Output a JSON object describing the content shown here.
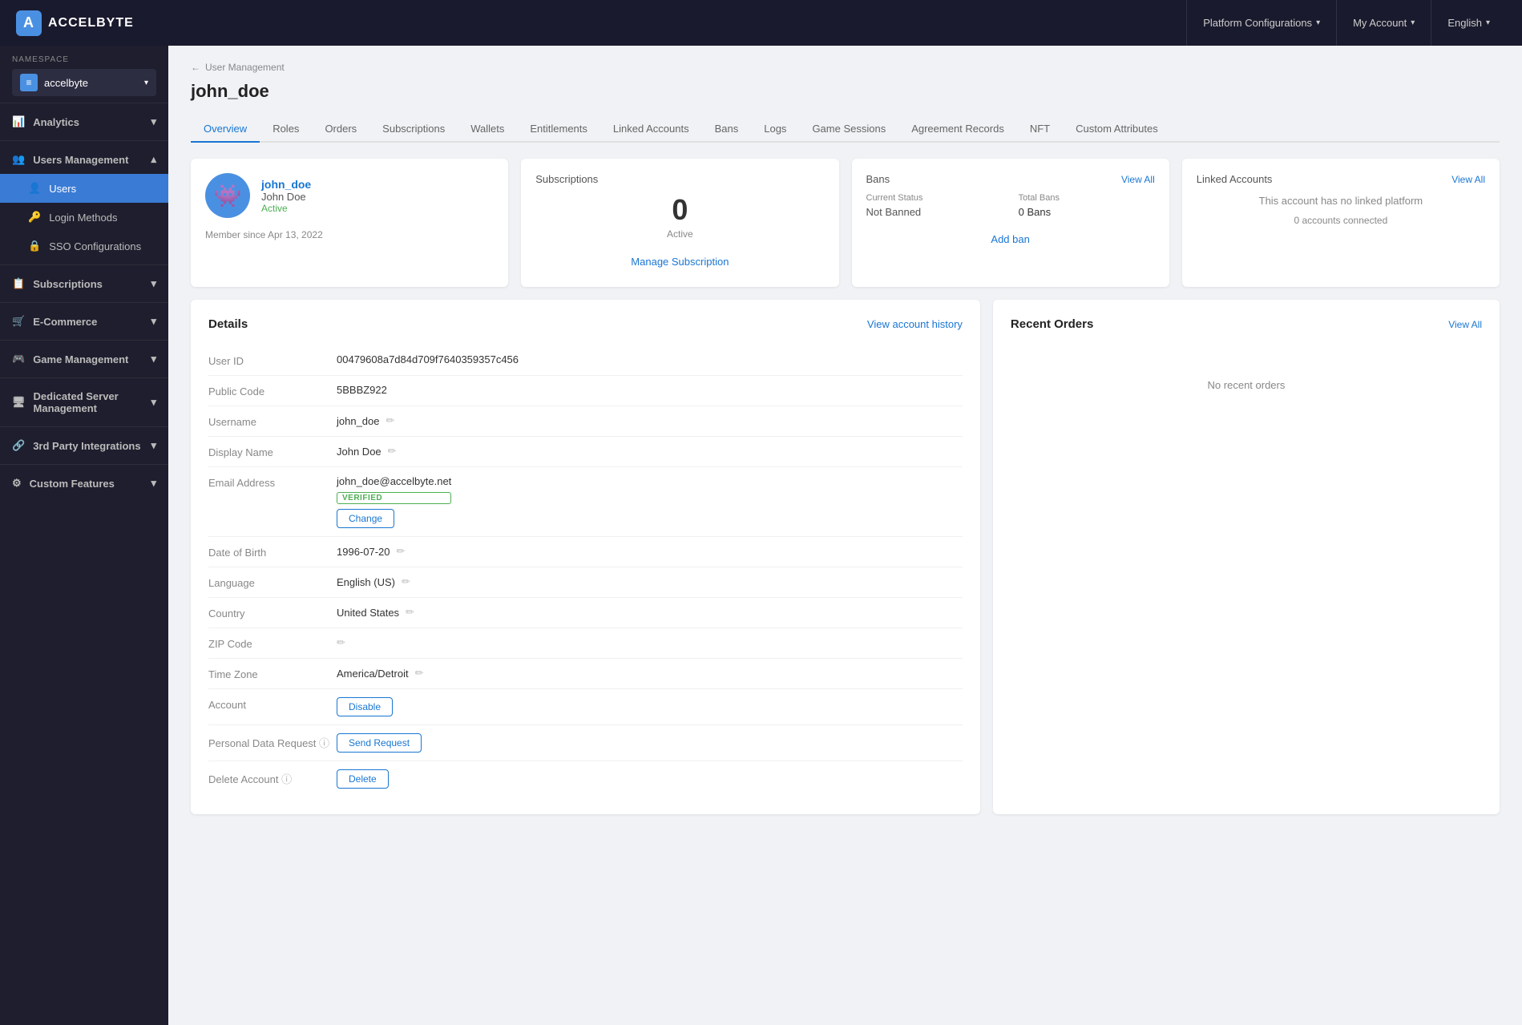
{
  "topNav": {
    "logo": "ACCELBYTE",
    "platformConfigurations": "Platform Configurations",
    "myAccount": "My Account",
    "english": "English"
  },
  "sidebar": {
    "namespaceLabel": "NAMESPACE",
    "namespace": "accelbyte",
    "sections": [
      {
        "id": "analytics",
        "label": "Analytics",
        "expandable": true
      },
      {
        "id": "usersManagement",
        "label": "Users Management",
        "expandable": true,
        "expanded": true
      },
      {
        "id": "users",
        "label": "Users",
        "sub": true,
        "active": true
      },
      {
        "id": "loginMethods",
        "label": "Login Methods",
        "sub": true
      },
      {
        "id": "ssoConfigurations",
        "label": "SSO Configurations",
        "sub": true
      },
      {
        "id": "subscriptions",
        "label": "Subscriptions",
        "expandable": true
      },
      {
        "id": "eCommerce",
        "label": "E-Commerce",
        "expandable": true
      },
      {
        "id": "gameManagement",
        "label": "Game Management",
        "expandable": true
      },
      {
        "id": "dedicatedServerManagement",
        "label": "Dedicated Server Management",
        "expandable": true
      },
      {
        "id": "thirdPartyIntegrations",
        "label": "3rd Party Integrations",
        "expandable": true
      },
      {
        "id": "customFeatures",
        "label": "Custom Features",
        "expandable": true
      }
    ]
  },
  "breadcrumb": {
    "parent": "User Management",
    "arrow": "←"
  },
  "pageTitle": "john_doe",
  "tabs": [
    {
      "id": "overview",
      "label": "Overview",
      "active": true
    },
    {
      "id": "roles",
      "label": "Roles"
    },
    {
      "id": "orders",
      "label": "Orders"
    },
    {
      "id": "subscriptions",
      "label": "Subscriptions"
    },
    {
      "id": "wallets",
      "label": "Wallets"
    },
    {
      "id": "entitlements",
      "label": "Entitlements"
    },
    {
      "id": "linkedAccounts",
      "label": "Linked Accounts"
    },
    {
      "id": "bans",
      "label": "Bans"
    },
    {
      "id": "logs",
      "label": "Logs"
    },
    {
      "id": "gameSessions",
      "label": "Game Sessions"
    },
    {
      "id": "agreementRecords",
      "label": "Agreement Records"
    },
    {
      "id": "nft",
      "label": "NFT"
    },
    {
      "id": "customAttributes",
      "label": "Custom Attributes"
    }
  ],
  "userCard": {
    "username": "john_doe",
    "displayName": "John Doe",
    "status": "Active",
    "memberSince": "Member since Apr 13, 2022"
  },
  "subscriptionsCard": {
    "title": "Subscriptions",
    "count": "0",
    "countLabel": "Active",
    "manageButton": "Manage Subscription"
  },
  "bansCard": {
    "title": "Bans",
    "viewAll": "View All",
    "currentStatusLabel": "Current Status",
    "totalBansLabel": "Total Bans",
    "currentStatus": "Not Banned",
    "totalBans": "0 Bans",
    "addBan": "Add ban"
  },
  "linkedAccountsCard": {
    "title": "Linked Accounts",
    "viewAll": "View All",
    "emptyText": "This account has no linked platform",
    "accountsConnected": "0 accounts connected"
  },
  "details": {
    "title": "Details",
    "viewHistory": "View account history",
    "fields": [
      {
        "label": "User ID",
        "value": "00479608a7d84d709f7640359357c456",
        "editable": false,
        "type": "text"
      },
      {
        "label": "Public Code",
        "value": "5BBBZ922",
        "editable": false,
        "type": "text"
      },
      {
        "label": "Username",
        "value": "john_doe",
        "editable": true,
        "type": "text"
      },
      {
        "label": "Display Name",
        "value": "John Doe",
        "editable": true,
        "type": "text"
      },
      {
        "label": "Email Address",
        "value": "john_doe@accelbyte.net",
        "editable": false,
        "type": "email",
        "verified": true,
        "changeButton": "Change"
      },
      {
        "label": "Date of Birth",
        "value": "1996-07-20",
        "editable": true,
        "type": "text"
      },
      {
        "label": "Language",
        "value": "English (US)",
        "editable": true,
        "type": "text"
      },
      {
        "label": "Country",
        "value": "United States",
        "editable": true,
        "type": "text"
      },
      {
        "label": "ZIP Code",
        "value": "",
        "editable": true,
        "type": "text"
      },
      {
        "label": "Time Zone",
        "value": "America/Detroit",
        "editable": true,
        "type": "text"
      },
      {
        "label": "Account",
        "value": "",
        "editable": false,
        "type": "disable",
        "disableButton": "Disable"
      },
      {
        "label": "Personal Data Request",
        "value": "",
        "editable": false,
        "type": "sendRequest",
        "sendRequestButton": "Send Request",
        "hasInfo": true
      },
      {
        "label": "Delete Account",
        "value": "",
        "editable": false,
        "type": "delete",
        "deleteButton": "Delete",
        "hasInfo": true
      }
    ]
  },
  "recentOrders": {
    "title": "Recent Orders",
    "viewAll": "View All",
    "emptyText": "No recent orders"
  }
}
